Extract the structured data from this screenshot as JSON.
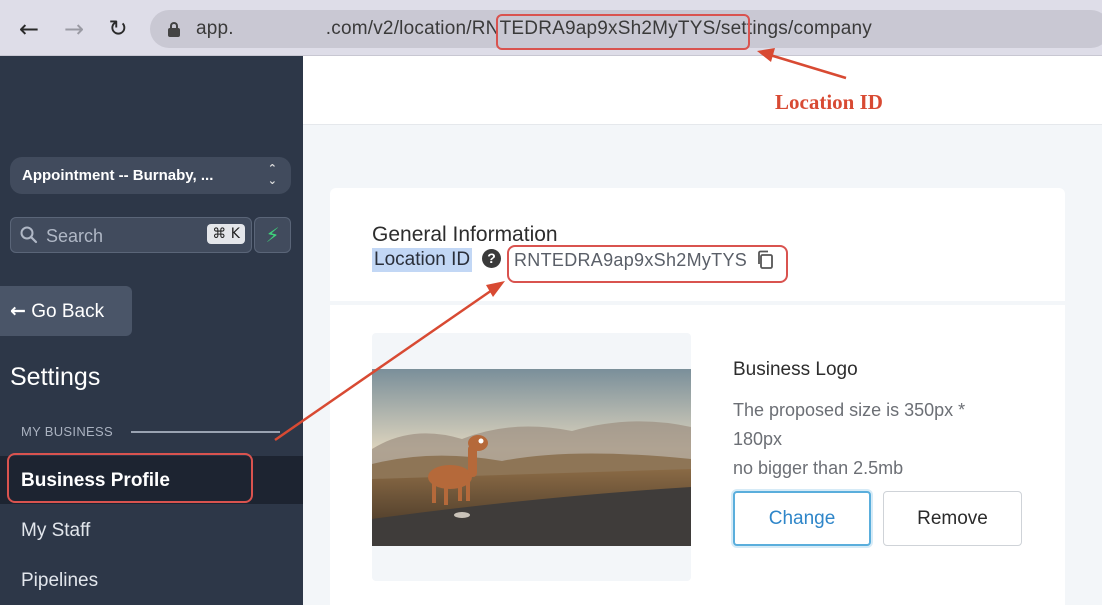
{
  "browser": {
    "url_prefix": "app.",
    "url_mid": ".com/v2/location/",
    "url_highlight": "RNTEDRA9ap9xSh2MyTYS",
    "url_suffix": "/settings/company"
  },
  "annotation": {
    "callout_label": "Location ID"
  },
  "sidebar": {
    "location_select": "Appointment -- Burnaby, ...",
    "search_placeholder": "Search",
    "search_shortcut": "⌘ K",
    "go_back_label": "Go Back",
    "settings_title": "Settings",
    "section_label": "MY BUSINESS",
    "items": [
      {
        "label": "Business Profile",
        "active": true
      },
      {
        "label": "My Staff",
        "active": false
      },
      {
        "label": "Pipelines",
        "active": false
      }
    ]
  },
  "main": {
    "general_info_title": "General Information",
    "location_id_label": "Location ID",
    "location_id_value": "RNTEDRA9ap9xSh2MyTYS",
    "logo": {
      "title": "Business Logo",
      "desc_line1": "The proposed size is 350px *",
      "desc_line2": "180px",
      "desc_line3": "no bigger than 2.5mb",
      "change_label": "Change",
      "remove_label": "Remove"
    }
  },
  "colors": {
    "sidebar_bg": "#2d3748",
    "annotation_red": "#d9534f",
    "accent_blue": "#2f86c9"
  }
}
